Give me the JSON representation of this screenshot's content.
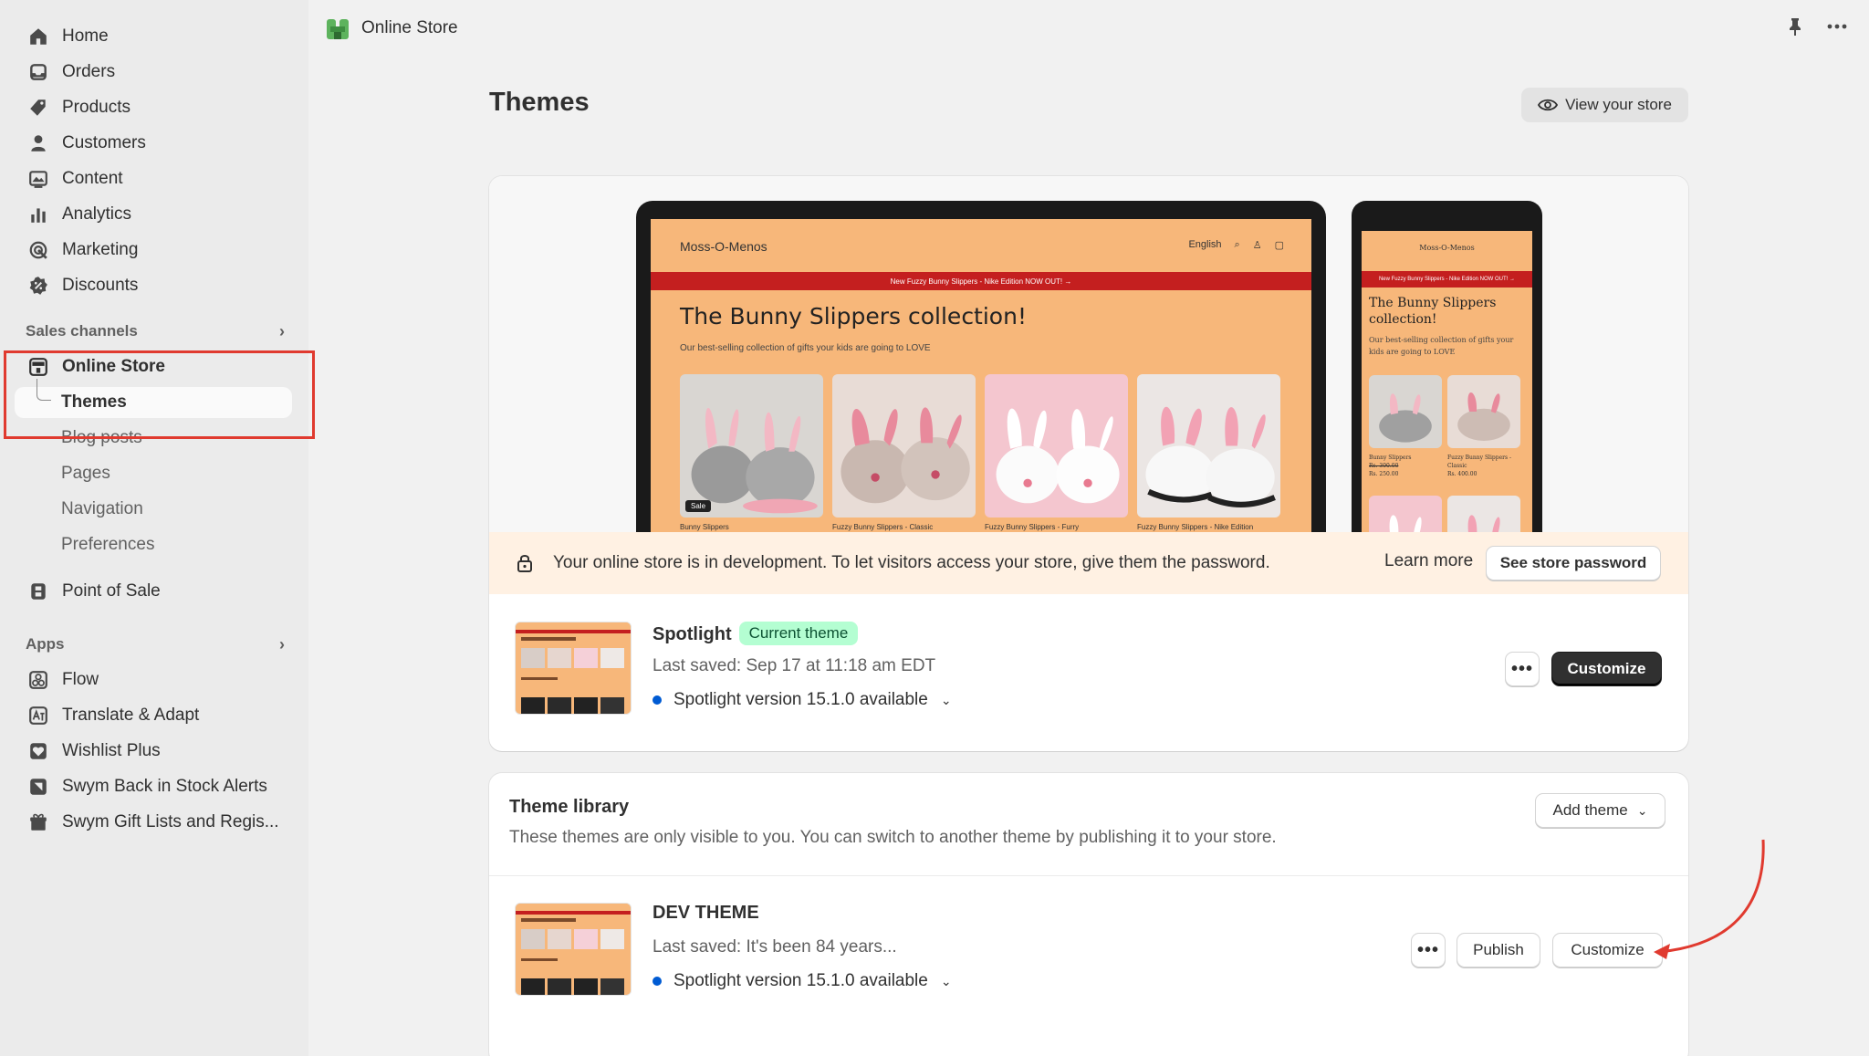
{
  "sidebar": {
    "main_items": [
      {
        "label": "Home",
        "icon": "home-icon"
      },
      {
        "label": "Orders",
        "icon": "orders-icon"
      },
      {
        "label": "Products",
        "icon": "tag-icon"
      },
      {
        "label": "Customers",
        "icon": "person-icon"
      },
      {
        "label": "Content",
        "icon": "image-icon"
      },
      {
        "label": "Analytics",
        "icon": "bar-chart-icon"
      },
      {
        "label": "Marketing",
        "icon": "target-icon"
      },
      {
        "label": "Discounts",
        "icon": "discount-icon"
      }
    ],
    "sales_channels_label": "Sales channels",
    "online_store": "Online Store",
    "online_store_sub": [
      "Themes",
      "Blog posts",
      "Pages",
      "Navigation",
      "Preferences"
    ],
    "point_of_sale": "Point of Sale",
    "apps_label": "Apps",
    "apps": [
      "Flow",
      "Translate & Adapt",
      "Wishlist Plus",
      "Swym Back in Stock Alerts",
      "Swym Gift Lists and Regis..."
    ]
  },
  "topbar": {
    "title": "Online Store"
  },
  "page": {
    "title": "Themes",
    "view_store": "View your store"
  },
  "preview": {
    "brand": "Moss-O-Menos",
    "language": "English",
    "banner": "New Fuzzy Bunny Slippers - Nike Edition NOW OUT! →",
    "hero": "The Bunny Slippers collection!",
    "sub": "Our best-selling collection of gifts your kids are going to LOVE",
    "product_names": [
      "Bunny Slippers",
      "Fuzzy Bunny Slippers - Classic",
      "Fuzzy Bunny Slippers - Furry",
      "Fuzzy Bunny Slippers - Nike Edition"
    ],
    "sale_label": "Sale",
    "phone_brand": "Moss-O-Menos",
    "phone_banner": "New Fuzzy Bunny Slippers - Nike Edition NOW OUT! →",
    "phone_hero": "The Bunny Slippers collection!",
    "phone_sub": "Our best-selling collection of gifts your kids are going to LOVE",
    "phone_p1": "Bunny Slippers",
    "phone_p1_price_old": "Rs. 300.00",
    "phone_p1_price": "Rs. 250.00",
    "phone_p2": "Fuzzy Bunny Slippers - Classic",
    "phone_p2_price": "Rs. 400.00"
  },
  "dev_banner": {
    "text": "Your online store is in development. To let visitors access your store, give them the password.",
    "learn_more": "Learn more",
    "button": "See store password"
  },
  "current_theme": {
    "name": "Spotlight",
    "badge": "Current theme",
    "saved": "Last saved: Sep 17 at 11:18 am EDT",
    "version": "Spotlight version 15.1.0 available",
    "customize": "Customize"
  },
  "library": {
    "title": "Theme library",
    "description": "These themes are only visible to you. You can switch to another theme by publishing it to your store.",
    "add_theme": "Add theme",
    "themes": [
      {
        "name": "DEV THEME",
        "saved": "Last saved: It's been 84 years...",
        "version": "Spotlight version 15.1.0 available",
        "publish": "Publish",
        "customize": "Customize"
      }
    ]
  },
  "colors": {
    "highlight": "#e03a2f",
    "accent_green": "#b4fed2",
    "store_orange": "#f7b77a",
    "store_red": "#c41f1f",
    "version_dot": "#005bd3"
  }
}
